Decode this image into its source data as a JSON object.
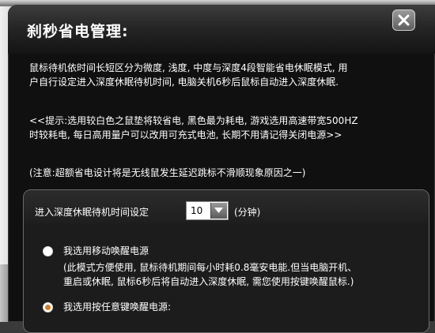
{
  "window": {
    "title": "刹秒省电管理:"
  },
  "content": {
    "description_line1": "鼠标待机依时间长短区分为微度, 浅度, 中度与深度4段智能省电休眠模式, 用",
    "description_line2": "户自行设定进入深度休眠待机时间, 电脑关机6秒后鼠标自动进入深度休眠.",
    "tip_line1": "<<提示:选用较白色之鼠垫将较省电, 黑色最为耗电, 游戏选用高速带宽500HZ",
    "tip_line2": "时较耗电, 每日高用量户可以改用可充式电池, 长期不用请记得关闭电源>>",
    "note": "(注意:超额省电设计将是无线鼠发生延迟跳标不滑顺现象原因之一)"
  },
  "settings": {
    "sleep_label": "进入深度休眠待机时间设定",
    "sleep_value": "10",
    "sleep_unit": "(分钟)",
    "option_mobile_label": "我选用移动唤醒电源",
    "option_mobile_selected": false,
    "option_mobile_desc1": "(此模式方便使用, 鼠标待机期间每小时耗0.8毫安电能.但当电脑开机、",
    "option_mobile_desc2": "重启或休眠, 鼠标6秒后将自动进入深度休眠, 需您使用按键唤醒鼠标.)",
    "option_key_label": "我选用按任意键唤醒电源:",
    "option_key_selected": true
  },
  "colors": {
    "window_bg": "#101010",
    "radio_accent": "#e07a1c",
    "text": "#ffffff"
  },
  "icons": {
    "close": "close-icon",
    "dropdown": "chevron-down-icon"
  }
}
